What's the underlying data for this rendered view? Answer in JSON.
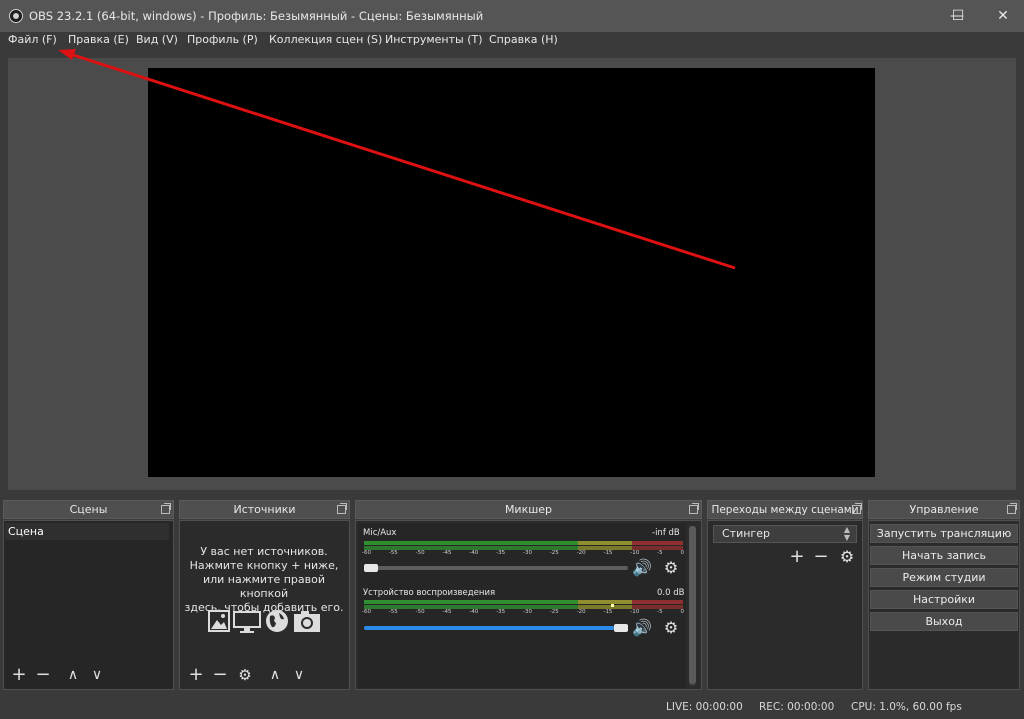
{
  "window": {
    "title": "OBS 23.2.1 (64-bit, windows) - Профиль: Безымянный - Сцены: Безымянный",
    "minimize": "—",
    "maximize": "☐",
    "close": "✕"
  },
  "menu": {
    "items": [
      {
        "label": "Файл (F)"
      },
      {
        "label": "Правка (E)"
      },
      {
        "label": "Вид (V)"
      },
      {
        "label": "Профиль (P)"
      },
      {
        "label": "Коллекция сцен (S)"
      },
      {
        "label": "Инструменты (T)"
      },
      {
        "label": "Справка (H)"
      }
    ]
  },
  "annotation": {
    "arrow_color": "#dd1111"
  },
  "docks": {
    "scenes": {
      "title": "Сцены",
      "items": [
        "Сцена"
      ]
    },
    "sources": {
      "title": "Источники",
      "empty_lines": [
        "У вас нет источников.",
        "Нажмите кнопку + ниже,",
        "или нажмите правой кнопкой",
        "здесь, чтобы добавить его."
      ]
    },
    "mixer": {
      "title": "Микшер",
      "channels": [
        {
          "name": "Mic/Aux",
          "level_text": "-inf dB",
          "volume": 0.0
        },
        {
          "name": "Устройство воспроизведения",
          "level_text": "0.0 dB",
          "volume": 1.0
        }
      ],
      "ticks": [
        "-60",
        "-55",
        "-50",
        "-45",
        "-40",
        "-35",
        "-30",
        "-25",
        "-20",
        "-15",
        "-10",
        "-5",
        "0"
      ]
    },
    "transitions": {
      "title": "Переходы между сценами",
      "selected": "Стингер"
    },
    "controls": {
      "title": "Управление",
      "buttons": [
        "Запустить трансляцию",
        "Начать запись",
        "Режим студии",
        "Настройки",
        "Выход"
      ]
    }
  },
  "tool_glyphs": {
    "add": "+",
    "remove": "−",
    "up": "∧",
    "down": "∨",
    "gear": "⚙"
  },
  "status": {
    "live": "LIVE: 00:00:00",
    "rec": "REC: 00:00:00",
    "cpu": "CPU: 1.0%, 60.00 fps"
  },
  "colors": {
    "meter_green": "#2f8f2f",
    "meter_yellow": "#8f8f2f",
    "meter_red": "#8f2f2f",
    "slider_blue": "#2c8ae8"
  }
}
